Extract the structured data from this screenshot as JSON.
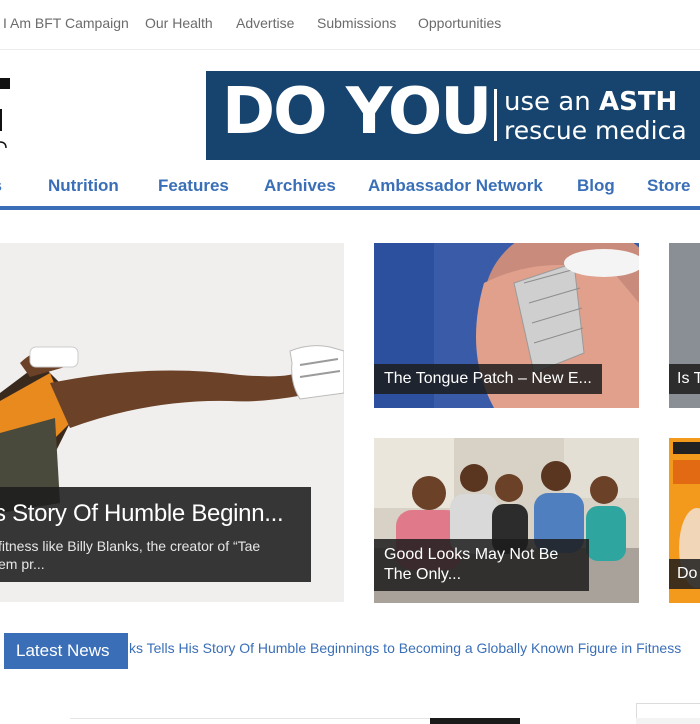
{
  "top_nav": [
    "I Am BFT Campaign",
    "Our Health",
    "Advertise",
    "Submissions",
    "Opportunities"
  ],
  "banner": {
    "headline": "DO YOU",
    "line1_pre": "use an ",
    "line1_bold": "ASTH",
    "line2": "rescue medica",
    "bg_color": "#16446e"
  },
  "main_nav": [
    "ss",
    "Nutrition",
    "Features",
    "Archives",
    "Ambassador Network",
    "Blog",
    "Store"
  ],
  "feature": {
    "title": "s Story Of Humble Beginn...",
    "excerpt_line1": "fitness like Billy Blanks, the creator of “Tae",
    "excerpt_line2": "em pr..."
  },
  "tiles": {
    "tongue": "The Tongue Patch – New E...",
    "family": "Good Looks May Not Be The Only...",
    "right1": "Is T",
    "right2": "Do"
  },
  "latest_news": {
    "label": "Latest News",
    "ticker": "ks Tells His Story Of Humble Beginnings to Becoming a Globally Known Figure in Fitness"
  },
  "colors": {
    "accent": "#3a6fb8",
    "caption_bg": "#1c1c1c"
  }
}
